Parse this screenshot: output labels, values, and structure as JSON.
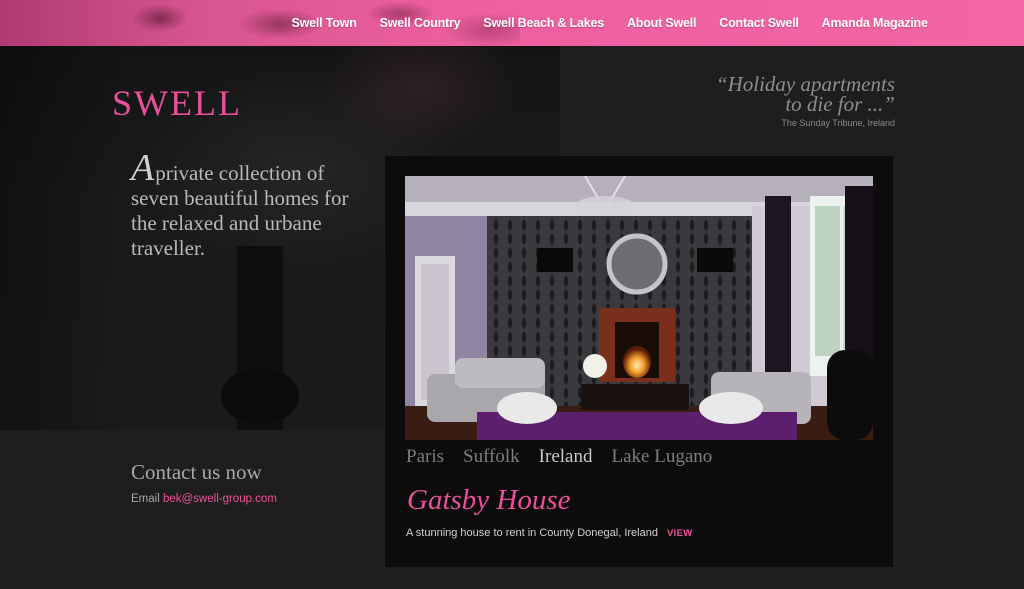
{
  "nav": {
    "items": [
      {
        "label": "Swell Town"
      },
      {
        "label": "Swell Country"
      },
      {
        "label": "Swell Beach & Lakes"
      },
      {
        "label": "About Swell"
      },
      {
        "label": "Contact Swell"
      },
      {
        "label": "Amanda Magazine"
      }
    ]
  },
  "brand": {
    "logo": "SWELL"
  },
  "hero": {
    "dropcap": "A",
    "tagline": "private collection of seven beautiful homes for the relaxed and urbane traveller."
  },
  "quote": {
    "line1": "“Holiday apartments",
    "line2": "to die for ...”",
    "source": "The Sunday Tribune, Ireland"
  },
  "contact": {
    "title": "Contact us now",
    "email_label": "Email",
    "email": "bek@swell-group.com"
  },
  "gallery": {
    "locations": [
      {
        "label": "Paris",
        "active": false
      },
      {
        "label": "Suffolk",
        "active": false
      },
      {
        "label": "Ireland",
        "active": true
      },
      {
        "label": "Lake Lugano",
        "active": false
      }
    ],
    "house_title": "Gatsby House",
    "house_desc": "A stunning house to rent in County Donegal, Ireland",
    "view_label": "VIEW"
  },
  "colors": {
    "accent": "#ef4f9b",
    "topbar": "#f266a6",
    "background": "#1e1e1e",
    "panel": "#0c0c0c"
  }
}
